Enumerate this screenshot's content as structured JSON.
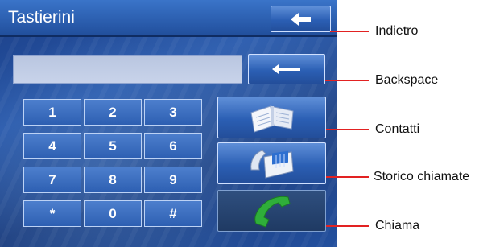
{
  "window": {
    "title": "Tastierini"
  },
  "keypad": {
    "keys": [
      "1",
      "2",
      "3",
      "4",
      "5",
      "6",
      "7",
      "8",
      "9",
      "*",
      "0",
      "#"
    ]
  },
  "display": {
    "value": ""
  },
  "callouts": {
    "back": "Indietro",
    "backspace": "Backspace",
    "contacts": "Contatti",
    "history": "Storico chiamate",
    "call": "Chiama"
  },
  "colors": {
    "leader_line": "#e22222",
    "call_icon": "#2fae3a"
  }
}
